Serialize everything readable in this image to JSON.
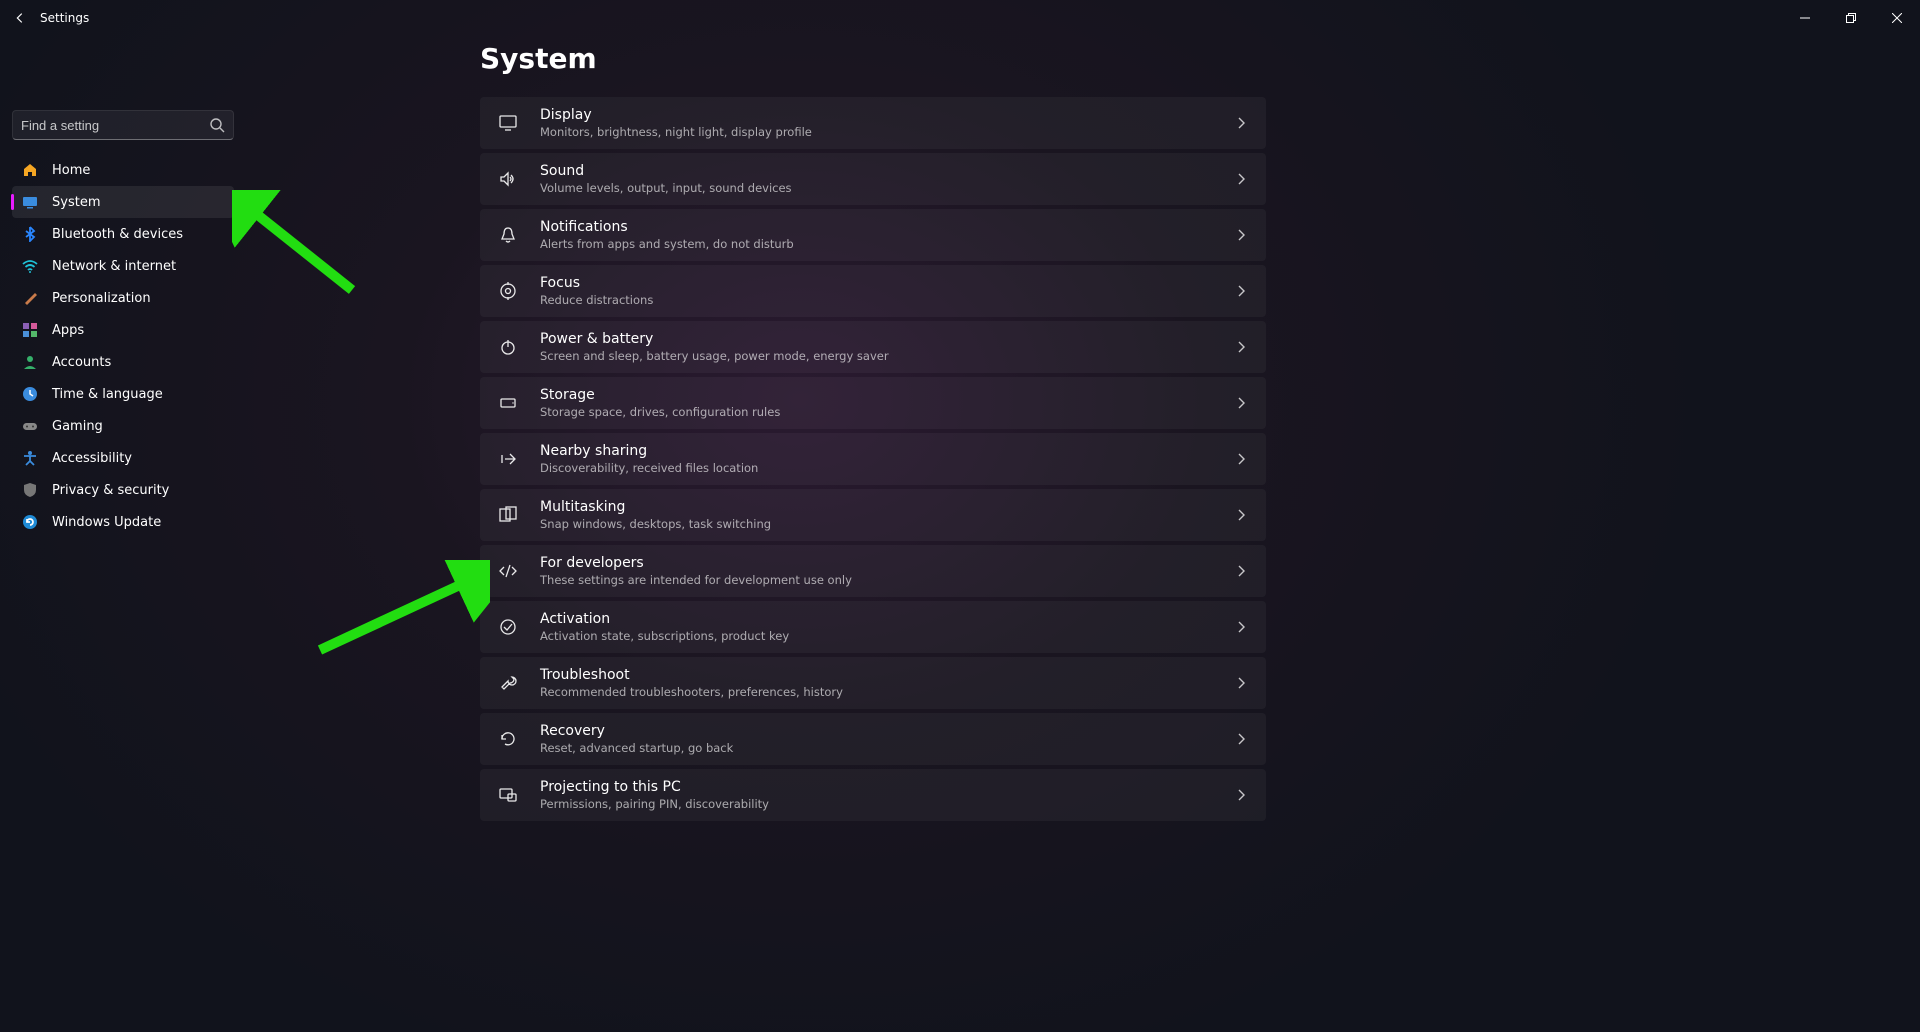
{
  "window": {
    "title": "Settings"
  },
  "search": {
    "placeholder": "Find a setting"
  },
  "sidebar": {
    "items": [
      {
        "label": "Home",
        "icon": "home"
      },
      {
        "label": "System",
        "icon": "system",
        "active": true
      },
      {
        "label": "Bluetooth & devices",
        "icon": "bluetooth"
      },
      {
        "label": "Network & internet",
        "icon": "wifi"
      },
      {
        "label": "Personalization",
        "icon": "brush"
      },
      {
        "label": "Apps",
        "icon": "apps"
      },
      {
        "label": "Accounts",
        "icon": "person"
      },
      {
        "label": "Time & language",
        "icon": "clock"
      },
      {
        "label": "Gaming",
        "icon": "gamepad"
      },
      {
        "label": "Accessibility",
        "icon": "accessibility"
      },
      {
        "label": "Privacy & security",
        "icon": "shield"
      },
      {
        "label": "Windows Update",
        "icon": "update"
      }
    ]
  },
  "page": {
    "title": "System",
    "items": [
      {
        "title": "Display",
        "desc": "Monitors, brightness, night light, display profile",
        "icon": "display"
      },
      {
        "title": "Sound",
        "desc": "Volume levels, output, input, sound devices",
        "icon": "sound"
      },
      {
        "title": "Notifications",
        "desc": "Alerts from apps and system, do not disturb",
        "icon": "bell"
      },
      {
        "title": "Focus",
        "desc": "Reduce distractions",
        "icon": "focus"
      },
      {
        "title": "Power & battery",
        "desc": "Screen and sleep, battery usage, power mode, energy saver",
        "icon": "power"
      },
      {
        "title": "Storage",
        "desc": "Storage space, drives, configuration rules",
        "icon": "storage"
      },
      {
        "title": "Nearby sharing",
        "desc": "Discoverability, received files location",
        "icon": "share"
      },
      {
        "title": "Multitasking",
        "desc": "Snap windows, desktops, task switching",
        "icon": "multi"
      },
      {
        "title": "For developers",
        "desc": "These settings are intended for development use only",
        "icon": "dev"
      },
      {
        "title": "Activation",
        "desc": "Activation state, subscriptions, product key",
        "icon": "check"
      },
      {
        "title": "Troubleshoot",
        "desc": "Recommended troubleshooters, preferences, history",
        "icon": "wrench"
      },
      {
        "title": "Recovery",
        "desc": "Reset, advanced startup, go back",
        "icon": "recovery"
      },
      {
        "title": "Projecting to this PC",
        "desc": "Permissions, pairing PIN, discoverability",
        "icon": "project"
      }
    ]
  }
}
